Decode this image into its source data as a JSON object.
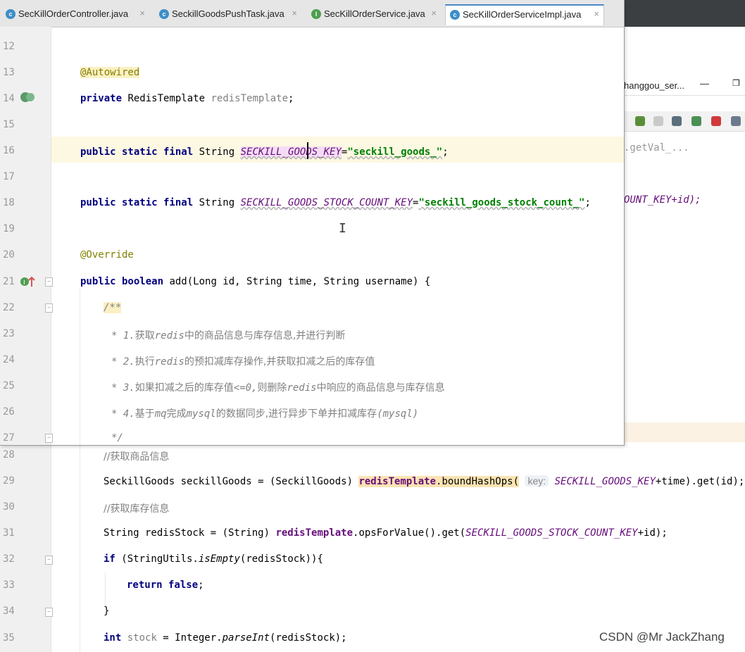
{
  "tabs": [
    {
      "label": "SecKillOrderController.java",
      "icon": "class-icon",
      "icon_letter": "c",
      "active": false
    },
    {
      "label": "SeckillGoodsPushTask.java",
      "icon": "class-icon",
      "icon_letter": "c",
      "active": false
    },
    {
      "label": "SecKillOrderService.java",
      "icon": "interface-icon",
      "icon_letter": "I",
      "active": false
    },
    {
      "label": "SecKillOrderServiceImpl.java",
      "icon": "class-icon",
      "icon_letter": "c",
      "active": true
    }
  ],
  "tab_close": "×",
  "background_window": {
    "title": "hanggou_ser...",
    "min": "—",
    "max": "❐",
    "code_lines": [
      ".getVal_...",
      "OUNT_KEY+id);"
    ]
  },
  "editor": {
    "lines": [
      {
        "num": "12"
      },
      {
        "num": "13",
        "annotation": "@Autowired"
      },
      {
        "num": "14",
        "kw": "private",
        "type": "RedisTemplate",
        "name": "redisTemplate",
        "end": ";"
      },
      {
        "num": "15"
      },
      {
        "num": "16",
        "mods": "public static final",
        "type": "String",
        "field": "SECKILL_GOODS_KEY",
        "eq": "=",
        "value": "\"seckill_goods_\"",
        "end": ";"
      },
      {
        "num": "17"
      },
      {
        "num": "18",
        "mods": "public static final",
        "type": "String",
        "field": "SECKILL_GOODS_STOCK_COUNT_KEY",
        "eq": "=",
        "value": "\"seckill_goods_stock_count_\"",
        "end": ";"
      },
      {
        "num": "19"
      },
      {
        "num": "20",
        "annotation": "@Override"
      },
      {
        "num": "21",
        "mods": "public boolean",
        "sig": "add(Long id, String time, String username) {"
      },
      {
        "num": "22",
        "comment": "/**"
      },
      {
        "num": "23",
        "star": "* 1.",
        "t1": "获取",
        "t2": "redis",
        "t3": "中的商品信息与库存信息,并进行判断"
      },
      {
        "num": "24",
        "star": "* 2.",
        "t1": "执行",
        "t2": "redis",
        "t3": "的预扣减库存操作,并获取扣减之后的库存值"
      },
      {
        "num": "25",
        "star": "* 3.",
        "t1": "如果扣减之后的库存值",
        "t2": "<=0,",
        "t3": "则删除",
        "t4": "redis",
        "t5": "中响应的商品信息与库存信息"
      },
      {
        "num": "26",
        "star": "* 4.",
        "t1": "基于",
        "t2": "mq",
        "t3": "完成",
        "t4": "mysql",
        "t5": "的数据同步,进行异步下单并扣减库存",
        "t6": "(mysql)"
      },
      {
        "num": "27",
        "comment": "*/"
      }
    ]
  },
  "bottom": {
    "lines": [
      {
        "num": "28",
        "comment": "//获取商品信息"
      },
      {
        "num": "29",
        "a": "SeckillGoods seckillGoods = (SeckillGoods) ",
        "b": "redisTemplate",
        "c": ".boundHashOps(",
        "hint": "key:",
        "d": "SECKILL_GOODS_KEY",
        "e": "+time).get(id);"
      },
      {
        "num": "30",
        "comment": "//获取库存信息"
      },
      {
        "num": "31",
        "a": "String redisStock = (String) ",
        "b": "redisTemplate",
        "c": ".opsForValue().get(",
        "d": "SECKILL_GOODS_STOCK_COUNT_KEY",
        "e": "+id);"
      },
      {
        "num": "32",
        "kw": "if",
        "a": " (StringUtils.",
        "m": "isEmpty",
        "e": "(redisStock)){"
      },
      {
        "num": "33",
        "kw": "return false",
        "e": ";"
      },
      {
        "num": "34",
        "e": "}"
      },
      {
        "num": "35",
        "kw": "int",
        "v": " stock",
        "a": " = Integer.",
        "m": "parseInt",
        "e": "(redisStock);"
      }
    ]
  },
  "watermark": "CSDN @Mr JackZhang",
  "colors": {
    "keyword": "#000080",
    "string": "#008000",
    "field": "#660e7a",
    "annotation": "#808000",
    "comment": "#808080"
  }
}
